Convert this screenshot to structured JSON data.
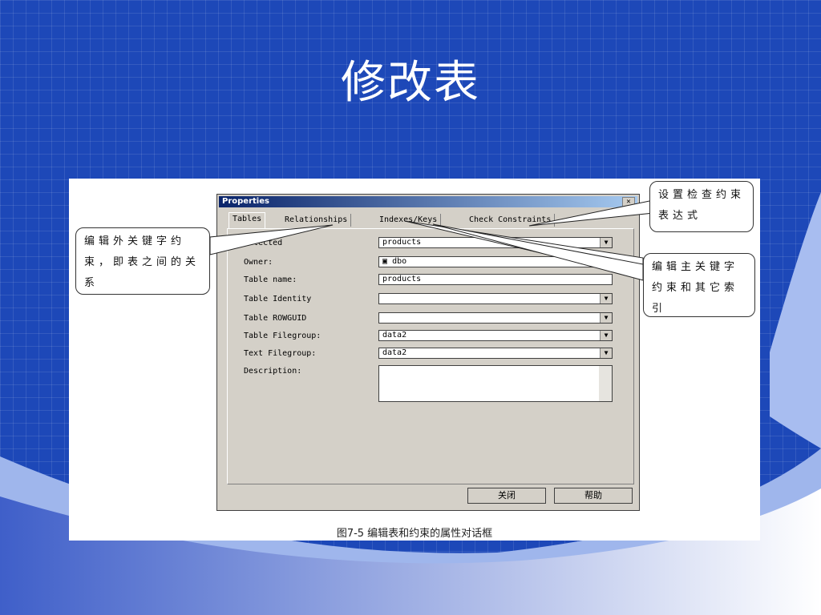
{
  "slide": {
    "title": "修改表",
    "caption": "图7-5  编辑表和约束的属性对话框"
  },
  "dialog": {
    "title": "Properties",
    "close_icon": "close-icon",
    "tabs": [
      "Tables",
      "Relationships",
      "Indexes/Keys",
      "Check Constraints"
    ],
    "fields": [
      {
        "label": "Selected",
        "value": "products",
        "dropdown": true
      },
      {
        "label": "Owner:",
        "value": "dbo",
        "dropdown": false
      },
      {
        "label": "Table name:",
        "value": "products",
        "dropdown": false
      },
      {
        "label": "Table Identity",
        "value": "",
        "dropdown": true
      },
      {
        "label": "Table ROWGUID",
        "value": "",
        "dropdown": true
      },
      {
        "label": "Table Filegroup:",
        "value": "data2",
        "dropdown": true
      },
      {
        "label": "Text Filegroup:",
        "value": "data2",
        "dropdown": true
      },
      {
        "label": "Description:",
        "value": "",
        "dropdown": false
      }
    ],
    "buttons": {
      "close": "关闭",
      "help": "帮助"
    }
  },
  "callouts": {
    "left": "编辑外关键字约束，即表之间的关系",
    "top_right": "设置检查约束表达式",
    "right": "编辑主关键字约束和其它索引"
  },
  "colors": {
    "background": "#1d48b8",
    "titlebar": "#0a246a",
    "dialog": "#d4d0c8"
  }
}
